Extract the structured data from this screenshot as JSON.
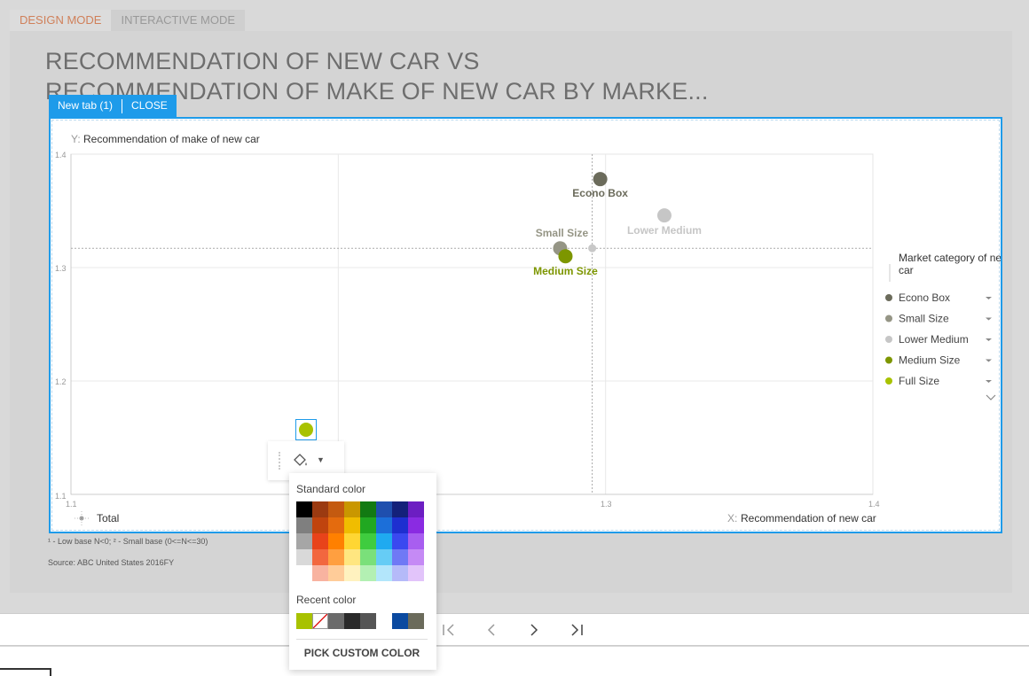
{
  "mode_tabs": [
    "DESIGN MODE",
    "INTERACTIVE MODE"
  ],
  "title_line1": "RECOMMENDATION OF NEW CAR VS",
  "title_line2": "RECOMMENDATION OF MAKE OF NEW CAR BY MARKE...",
  "tab_bar": {
    "tab_label": "New tab (1)",
    "close_label": "CLOSE"
  },
  "chart_data": {
    "type": "scatter",
    "y_axis_prefix": "Y:",
    "ylabel": "Recommendation of make of new car",
    "x_axis_prefix": "X:",
    "xlabel": "Recommendation of new car",
    "xlim": [
      1.1,
      1.4
    ],
    "ylim": [
      1.1,
      1.4
    ],
    "x_ticks": [
      "1.1",
      "1.3",
      "1.4"
    ],
    "y_ticks": [
      "1.4",
      "1.3",
      "1.2",
      "1.1"
    ],
    "ref_x": 1.295,
    "ref_y": 1.317,
    "grid": true,
    "legend_title": "Market category of new car",
    "legend_position": "right",
    "series": [
      {
        "name": "Econo Box",
        "x": 1.298,
        "y": 1.378,
        "color": "#6b6b5b"
      },
      {
        "name": "Small Size",
        "x": 1.283,
        "y": 1.317,
        "color": "#959585"
      },
      {
        "name": "Lower Medium",
        "x": 1.322,
        "y": 1.346,
        "color": "#c6c6c6"
      },
      {
        "name": "Medium Size",
        "x": 1.285,
        "y": 1.31,
        "color": "#7d9600"
      },
      {
        "name": "Full Size",
        "x": 1.189,
        "y": 1.157,
        "color": "#a8c200"
      }
    ],
    "total_label": "Total"
  },
  "footnote": "¹ - Low base N<0;   ² - Small base (0<=N<=30)",
  "source": "Source: ABC United States 2016FY",
  "color_picker": {
    "standard_label": "Standard color",
    "recent_label": "Recent color",
    "custom_label": "PICK CUSTOM COLOR",
    "standard_colors": [
      "#000000",
      "#9b3a11",
      "#c45a10",
      "#c99700",
      "#127a12",
      "#1f4fae",
      "#14217a",
      "#6c1ec2",
      "#7f7f7f",
      "#c0440e",
      "#e46b0e",
      "#f0bd00",
      "#21a821",
      "#1c6fd9",
      "#1e2fd0",
      "#8a2be2",
      "#a6a6a6",
      "#e8431a",
      "#ff8000",
      "#ffd633",
      "#3fcc3f",
      "#1faaf0",
      "#3a49f0",
      "#a85ef0",
      "#d9d9d9",
      "#f2673f",
      "#ff9f40",
      "#ffe680",
      "#7ae07a",
      "#66ccf5",
      "#6f79f5",
      "#c58af5",
      "#ffffff",
      "#f8b3a0",
      "#ffcc99",
      "#fff2bf",
      "#b3f0b3",
      "#b3e6fb",
      "#b5baf9",
      "#e2c4fa"
    ],
    "recent_colors": [
      "#a8c200",
      "none",
      "#6b6b6b",
      "#2a2a2a",
      "#555555",
      "#ffffff",
      "#0b4aa0",
      "#6b6b5b"
    ]
  }
}
